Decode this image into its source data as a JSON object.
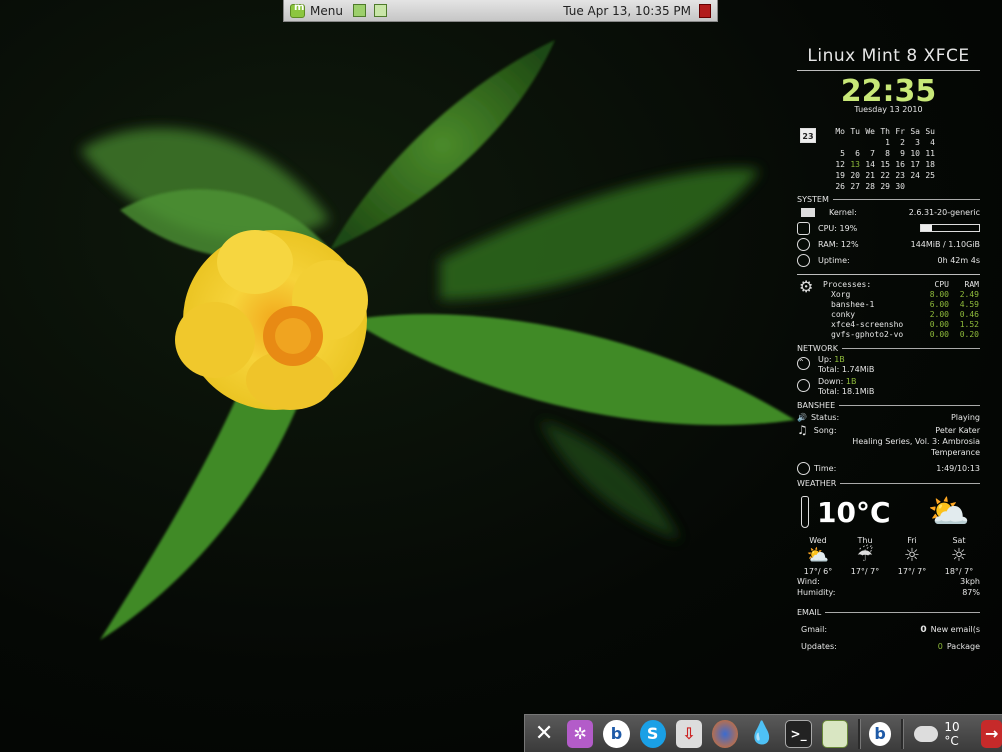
{
  "top_panel": {
    "menu_label": "Menu",
    "datetime": "Tue Apr 13, 10:35 PM"
  },
  "conky": {
    "distro": "Linux Mint 8 XFCE",
    "time": "22:35",
    "date": "Tuesday 13 2010",
    "calendar": {
      "icon_day": "23",
      "weekdays": [
        "Mo",
        "Tu",
        "We",
        "Th",
        "Fr",
        "Sa",
        "Su"
      ],
      "weeks": [
        [
          "",
          "",
          "",
          "1",
          "2",
          "3",
          "4"
        ],
        [
          "5",
          "6",
          "7",
          "8",
          "9",
          "10",
          "11"
        ],
        [
          "12",
          "13",
          "14",
          "15",
          "16",
          "17",
          "18"
        ],
        [
          "19",
          "20",
          "21",
          "22",
          "23",
          "24",
          "25"
        ],
        [
          "26",
          "27",
          "28",
          "29",
          "30",
          "",
          ""
        ]
      ],
      "today": "13"
    },
    "system": {
      "header": "SYSTEM",
      "kernel_label": "Kernel:",
      "kernel_value": "2.6.31-20-generic",
      "cpu_label": "CPU: 19%",
      "cpu_fraction": 0.19,
      "ram_label": "RAM: 12%",
      "ram_value": "144MiB / 1.10GiB",
      "uptime_label": "Uptime:",
      "uptime_value": "0h 42m 4s"
    },
    "processes": {
      "label": "Processes:",
      "cpu_head": "CPU",
      "ram_head": "RAM",
      "rows": [
        {
          "name": "Xorg",
          "cpu": "8.00",
          "ram": "2.49"
        },
        {
          "name": "banshee-1",
          "cpu": "6.00",
          "ram": "4.59"
        },
        {
          "name": "conky",
          "cpu": "2.00",
          "ram": "0.46"
        },
        {
          "name": "xfce4-screensho",
          "cpu": "0.00",
          "ram": "1.52"
        },
        {
          "name": "gvfs-gphoto2-vo",
          "cpu": "0.00",
          "ram": "0.20"
        }
      ]
    },
    "network": {
      "header": "NETWORK",
      "up_label": "Up:",
      "up_value": "1B",
      "up_total": "Total: 1.74MiB",
      "down_label": "Down:",
      "down_value": "1B",
      "down_total": "Total: 18.1MiB"
    },
    "banshee": {
      "header": "BANSHEE",
      "status_label": "Status:",
      "status_value": "Playing",
      "song_label": "Song:",
      "artist": "Peter Kater",
      "title_line1": "Healing Series, Vol. 3: Ambrosia",
      "title_line2": "Temperance",
      "time_label": "Time:",
      "time_value": "1:49/10:13"
    },
    "weather": {
      "header": "WEATHER",
      "current_temp": "10°C",
      "days": [
        {
          "name": "Wed",
          "temps": "17°/ 6°",
          "icon": "sun-cloud-icon"
        },
        {
          "name": "Thu",
          "temps": "17°/ 7°",
          "icon": "cloud-rain-icon"
        },
        {
          "name": "Fri",
          "temps": "17°/ 7°",
          "icon": "sun-icon"
        },
        {
          "name": "Sat",
          "temps": "18°/ 7°",
          "icon": "sun-icon"
        }
      ],
      "wind_label": "Wind:",
      "wind_value": "3kph",
      "humidity_label": "Humidity:",
      "humidity_value": "87%"
    },
    "email": {
      "header": "EMAIL",
      "gmail_label": "Gmail:",
      "gmail_count": "0",
      "gmail_suffix": "New email(s",
      "updates_label": "Updates:",
      "updates_count": "0",
      "updates_suffix": "Package"
    }
  },
  "dock": {
    "weather_temp": "10 °C",
    "items": [
      "x-icon",
      "settings-icon",
      "banshee-icon",
      "skype-icon",
      "installer-icon",
      "firefox-icon",
      "water-drop-icon",
      "terminal-icon",
      "text-editor-icon",
      "banshee-running-icon"
    ]
  },
  "colors": {
    "accent_green": "#8fbc3b",
    "clock_green": "#c8e878"
  }
}
